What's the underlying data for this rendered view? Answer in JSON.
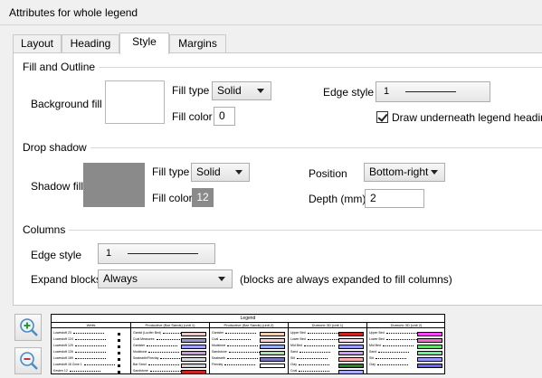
{
  "window": {
    "title": "Attributes for whole legend"
  },
  "tabs": [
    {
      "label": "Layout",
      "active": false
    },
    {
      "label": "Heading",
      "active": false
    },
    {
      "label": "Style",
      "active": true
    },
    {
      "label": "Margins",
      "active": false
    }
  ],
  "fill_outline": {
    "group_title": "Fill and Outline",
    "background_fill_label": "Background fill",
    "fill_type_label": "Fill type",
    "fill_type_value": "Solid",
    "fill_color_label": "Fill color",
    "fill_color_value": "0",
    "edge_style_label": "Edge style",
    "edge_style_value": "1",
    "draw_underneath_label": "Draw underneath legend heading",
    "draw_underneath_checked": true,
    "background_color": "#ffffff"
  },
  "drop_shadow": {
    "group_title": "Drop shadow",
    "shadow_fill_label": "Shadow fill",
    "fill_type_label": "Fill type",
    "fill_type_value": "Solid",
    "fill_color_label": "Fill color",
    "fill_color_value": "12",
    "position_label": "Position",
    "position_value": "Bottom-right",
    "depth_label": "Depth (mm)",
    "depth_value": "2",
    "shadow_color": "#8a8a8a"
  },
  "columns": {
    "group_title": "Columns",
    "edge_style_label": "Edge style",
    "edge_style_value": "1",
    "expand_blocks_label": "Expand blocks",
    "expand_blocks_value": "Always",
    "expand_hint": "(blocks are always expanded to fill columns)"
  },
  "zoom": {
    "in_icon": "zoom-in-icon",
    "out_icon": "zoom-out-icon"
  },
  "preview": {
    "title": "Legend",
    "columns": [
      {
        "heading": "Wells",
        "rows": [
          "Lowestoft 23",
          "Lowestoft 124",
          "Lowestoft 125",
          "Lowestoft 126",
          "Lowestoft 189",
          "Lowestoft 18 Zone 1",
          "Kesten 12"
        ],
        "swatches": []
      },
      {
        "heading": "Productive (Bar Sands) (unit 1)",
        "rows": [
          "Ganist (Lucifer Bed)",
          "Coal Measures",
          "Ganister",
          "Mudstone",
          "Seatearth/Fireclay",
          "Bar Sand",
          "Sandstone"
        ],
        "swatches": [
          "#e8c8c8",
          "#9999cc",
          "#a0a0ff",
          "#cc99cc",
          "#dddddd",
          "#d0d0d0",
          "#cc2222"
        ]
      },
      {
        "heading": "Productive (Bar Sands) (unit 2)",
        "rows": [
          "Ganister",
          "Coal",
          "Mudstone",
          "Sandstone",
          "Seatearth",
          "Fireclay"
        ],
        "swatches": [
          "#f0d0b0",
          "#ffd0d0",
          "#99aaee",
          "#aaddaa",
          "#7777bb",
          "#ffffff"
        ]
      },
      {
        "heading": "Dumoric 3D (unit 1)",
        "rows": [
          "Upper Bed",
          "Lower Bed",
          "Mid Bed",
          "Sand",
          "Silt",
          "Clay",
          "Coal"
        ],
        "swatches": [
          "#cc2222",
          "#ffe0f0",
          "#9999ff",
          "#cc99ff",
          "#ffb0b0",
          "#228822",
          "#aaaaff"
        ]
      },
      {
        "heading": "Dumoric 3D (unit 2)",
        "rows": [
          "Upper Bed",
          "Lower Bed",
          "Mid Bed",
          "Sand",
          "Silt",
          "Clay"
        ],
        "swatches": [
          "#ff44ff",
          "#ff66cc",
          "#66dd66",
          "#66ee99",
          "#9999ff",
          "#6666ff"
        ]
      }
    ]
  }
}
